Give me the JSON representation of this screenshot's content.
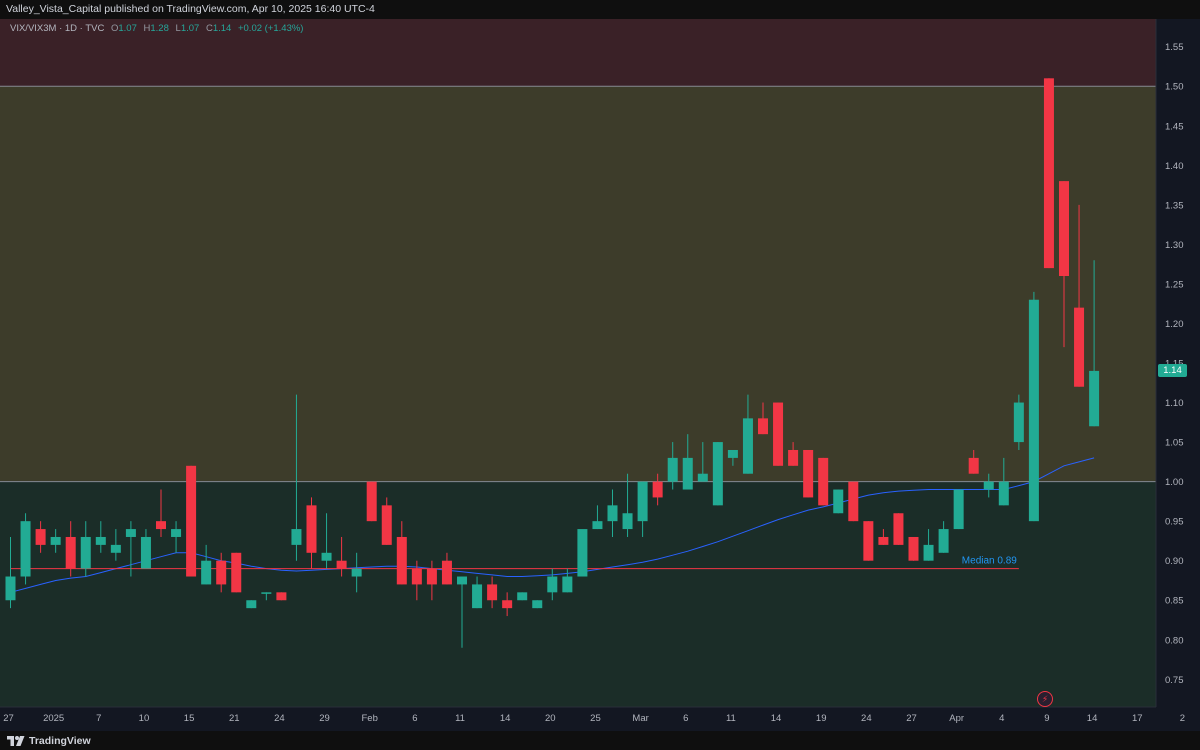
{
  "publisher": "Valley_Vista_Capital published on TradingView.com, Apr 10, 2025 16:40 UTC-4",
  "legend": {
    "symbol": "VIX/VIX3M · 1D · TVC",
    "open_label": "O",
    "open": "1.07",
    "high_label": "H",
    "high": "1.28",
    "low_label": "L",
    "low": "1.07",
    "close_label": "C",
    "close": "1.14",
    "change": "+0.02 (+1.43%)"
  },
  "footer": {
    "brand": "TradingView"
  },
  "colors": {
    "up": "#22ab94",
    "down": "#f23645",
    "ma": "#2962ff",
    "median_line": "#f23645",
    "median_label": "#2196f3",
    "zone_top": "#3a2127",
    "zone_mid": "#3d3c2a",
    "zone_low": "#1b2d28"
  },
  "chart_data": {
    "type": "candlestick",
    "ylim": [
      0.715,
      1.585
    ],
    "y_ticks": [
      "0.75",
      "0.80",
      "0.85",
      "0.90",
      "0.95",
      "1.00",
      "1.05",
      "1.10",
      "1.15",
      "1.20",
      "1.25",
      "1.30",
      "1.35",
      "1.40",
      "1.45",
      "1.50",
      "1.55"
    ],
    "x_ticks": [
      {
        "label": "27",
        "idx": 0
      },
      {
        "label": "2025",
        "idx": 3
      },
      {
        "label": "7",
        "idx": 6
      },
      {
        "label": "10",
        "idx": 9
      },
      {
        "label": "15",
        "idx": 12
      },
      {
        "label": "21",
        "idx": 15
      },
      {
        "label": "24",
        "idx": 18
      },
      {
        "label": "29",
        "idx": 21
      },
      {
        "label": "Feb",
        "idx": 24
      },
      {
        "label": "6",
        "idx": 27
      },
      {
        "label": "11",
        "idx": 30
      },
      {
        "label": "14",
        "idx": 33
      },
      {
        "label": "20",
        "idx": 36
      },
      {
        "label": "25",
        "idx": 39
      },
      {
        "label": "Mar",
        "idx": 42
      },
      {
        "label": "6",
        "idx": 45
      },
      {
        "label": "11",
        "idx": 48
      },
      {
        "label": "14",
        "idx": 51
      },
      {
        "label": "19",
        "idx": 54
      },
      {
        "label": "24",
        "idx": 57
      },
      {
        "label": "27",
        "idx": 60
      },
      {
        "label": "Apr",
        "idx": 63
      },
      {
        "label": "4",
        "idx": 66
      },
      {
        "label": "9",
        "idx": 69
      },
      {
        "label": "14",
        "idx": 72
      },
      {
        "label": "17",
        "idx": 75
      },
      {
        "label": "2",
        "idx": 78
      }
    ],
    "zones": [
      {
        "from": 1.5,
        "to": 1.585,
        "color": "#3a2127"
      },
      {
        "from": 1.0,
        "to": 1.5,
        "color": "#3d3c2a"
      },
      {
        "from": 0.715,
        "to": 1.0,
        "color": "#1b2d28"
      }
    ],
    "levels": [
      1.5,
      1.0
    ],
    "median": {
      "label": "Median 0.89",
      "value": 0.89,
      "from_idx": 0,
      "to_idx": 67
    },
    "last_price": "1.14",
    "candles": [
      {
        "o": 0.85,
        "h": 0.93,
        "l": 0.84,
        "c": 0.88
      },
      {
        "o": 0.88,
        "h": 0.96,
        "l": 0.87,
        "c": 0.95
      },
      {
        "o": 0.94,
        "h": 0.95,
        "l": 0.91,
        "c": 0.92
      },
      {
        "o": 0.92,
        "h": 0.94,
        "l": 0.91,
        "c": 0.93
      },
      {
        "o": 0.93,
        "h": 0.95,
        "l": 0.88,
        "c": 0.89
      },
      {
        "o": 0.89,
        "h": 0.95,
        "l": 0.88,
        "c": 0.93
      },
      {
        "o": 0.92,
        "h": 0.95,
        "l": 0.91,
        "c": 0.93
      },
      {
        "o": 0.91,
        "h": 0.94,
        "l": 0.9,
        "c": 0.92
      },
      {
        "o": 0.93,
        "h": 0.95,
        "l": 0.88,
        "c": 0.94
      },
      {
        "o": 0.89,
        "h": 0.94,
        "l": 0.89,
        "c": 0.93
      },
      {
        "o": 0.95,
        "h": 0.99,
        "l": 0.93,
        "c": 0.94
      },
      {
        "o": 0.93,
        "h": 0.95,
        "l": 0.91,
        "c": 0.94
      },
      {
        "o": 1.02,
        "h": 1.02,
        "l": 0.88,
        "c": 0.88
      },
      {
        "o": 0.87,
        "h": 0.92,
        "l": 0.87,
        "c": 0.9
      },
      {
        "o": 0.9,
        "h": 0.91,
        "l": 0.86,
        "c": 0.87
      },
      {
        "o": 0.91,
        "h": 0.91,
        "l": 0.86,
        "c": 0.86
      },
      {
        "o": 0.84,
        "h": 0.85,
        "l": 0.84,
        "c": 0.85
      },
      {
        "o": 0.86,
        "h": 0.86,
        "l": 0.85,
        "c": 0.86
      },
      {
        "o": 0.86,
        "h": 0.86,
        "l": 0.85,
        "c": 0.85
      },
      {
        "o": 0.92,
        "h": 1.11,
        "l": 0.9,
        "c": 0.94
      },
      {
        "o": 0.97,
        "h": 0.98,
        "l": 0.89,
        "c": 0.91
      },
      {
        "o": 0.9,
        "h": 0.96,
        "l": 0.89,
        "c": 0.91
      },
      {
        "o": 0.9,
        "h": 0.93,
        "l": 0.88,
        "c": 0.89
      },
      {
        "o": 0.88,
        "h": 0.91,
        "l": 0.86,
        "c": 0.89
      },
      {
        "o": 1.0,
        "h": 1.0,
        "l": 0.95,
        "c": 0.95
      },
      {
        "o": 0.97,
        "h": 0.98,
        "l": 0.92,
        "c": 0.92
      },
      {
        "o": 0.93,
        "h": 0.95,
        "l": 0.87,
        "c": 0.87
      },
      {
        "o": 0.89,
        "h": 0.9,
        "l": 0.85,
        "c": 0.87
      },
      {
        "o": 0.89,
        "h": 0.9,
        "l": 0.85,
        "c": 0.87
      },
      {
        "o": 0.9,
        "h": 0.91,
        "l": 0.87,
        "c": 0.87
      },
      {
        "o": 0.87,
        "h": 0.88,
        "l": 0.79,
        "c": 0.88
      },
      {
        "o": 0.84,
        "h": 0.88,
        "l": 0.84,
        "c": 0.87
      },
      {
        "o": 0.87,
        "h": 0.88,
        "l": 0.84,
        "c": 0.85
      },
      {
        "o": 0.85,
        "h": 0.86,
        "l": 0.83,
        "c": 0.84
      },
      {
        "o": 0.85,
        "h": 0.86,
        "l": 0.85,
        "c": 0.86
      },
      {
        "o": 0.84,
        "h": 0.85,
        "l": 0.84,
        "c": 0.85
      },
      {
        "o": 0.86,
        "h": 0.89,
        "l": 0.85,
        "c": 0.88
      },
      {
        "o": 0.86,
        "h": 0.89,
        "l": 0.86,
        "c": 0.88
      },
      {
        "o": 0.88,
        "h": 0.92,
        "l": 0.88,
        "c": 0.94
      },
      {
        "o": 0.94,
        "h": 0.97,
        "l": 0.94,
        "c": 0.95
      },
      {
        "o": 0.95,
        "h": 0.99,
        "l": 0.93,
        "c": 0.97
      },
      {
        "o": 0.94,
        "h": 1.01,
        "l": 0.93,
        "c": 0.96
      },
      {
        "o": 0.95,
        "h": 1.0,
        "l": 0.93,
        "c": 1.0
      },
      {
        "o": 1.0,
        "h": 1.01,
        "l": 0.97,
        "c": 0.98
      },
      {
        "o": 1.0,
        "h": 1.05,
        "l": 0.99,
        "c": 1.03
      },
      {
        "o": 0.99,
        "h": 1.06,
        "l": 0.99,
        "c": 1.03
      },
      {
        "o": 1.0,
        "h": 1.05,
        "l": 1.0,
        "c": 1.01
      },
      {
        "o": 0.97,
        "h": 1.05,
        "l": 0.97,
        "c": 1.05
      },
      {
        "o": 1.03,
        "h": 1.04,
        "l": 1.02,
        "c": 1.04
      },
      {
        "o": 1.01,
        "h": 1.11,
        "l": 1.01,
        "c": 1.08
      },
      {
        "o": 1.08,
        "h": 1.1,
        "l": 1.06,
        "c": 1.06
      },
      {
        "o": 1.1,
        "h": 1.1,
        "l": 1.02,
        "c": 1.02
      },
      {
        "o": 1.04,
        "h": 1.05,
        "l": 1.02,
        "c": 1.02
      },
      {
        "o": 1.04,
        "h": 1.04,
        "l": 0.98,
        "c": 0.98
      },
      {
        "o": 1.03,
        "h": 1.03,
        "l": 0.97,
        "c": 0.97
      },
      {
        "o": 0.96,
        "h": 0.99,
        "l": 0.96,
        "c": 0.99
      },
      {
        "o": 1.0,
        "h": 1.0,
        "l": 0.95,
        "c": 0.95
      },
      {
        "o": 0.95,
        "h": 0.95,
        "l": 0.9,
        "c": 0.9
      },
      {
        "o": 0.93,
        "h": 0.94,
        "l": 0.92,
        "c": 0.92
      },
      {
        "o": 0.96,
        "h": 0.96,
        "l": 0.92,
        "c": 0.92
      },
      {
        "o": 0.93,
        "h": 0.93,
        "l": 0.9,
        "c": 0.9
      },
      {
        "o": 0.9,
        "h": 0.94,
        "l": 0.9,
        "c": 0.92
      },
      {
        "o": 0.91,
        "h": 0.95,
        "l": 0.91,
        "c": 0.94
      },
      {
        "o": 0.94,
        "h": 0.99,
        "l": 0.94,
        "c": 0.99
      },
      {
        "o": 1.03,
        "h": 1.04,
        "l": 1.01,
        "c": 1.01
      },
      {
        "o": 0.99,
        "h": 1.01,
        "l": 0.98,
        "c": 1.0
      },
      {
        "o": 0.97,
        "h": 1.03,
        "l": 0.97,
        "c": 1.0
      },
      {
        "o": 1.05,
        "h": 1.11,
        "l": 1.04,
        "c": 1.1
      },
      {
        "o": 0.95,
        "h": 1.24,
        "l": 0.95,
        "c": 1.23
      },
      {
        "o": 1.51,
        "h": 1.51,
        "l": 1.27,
        "c": 1.27
      },
      {
        "o": 1.38,
        "h": 1.38,
        "l": 1.17,
        "c": 1.26
      },
      {
        "o": 1.22,
        "h": 1.35,
        "l": 1.12,
        "c": 1.12
      },
      {
        "o": 1.07,
        "h": 1.28,
        "l": 1.07,
        "c": 1.14
      }
    ],
    "ma": [
      0.86,
      0.865,
      0.87,
      0.875,
      0.878,
      0.88,
      0.885,
      0.89,
      0.895,
      0.9,
      0.905,
      0.91,
      0.91,
      0.905,
      0.9,
      0.897,
      0.893,
      0.89,
      0.888,
      0.887,
      0.888,
      0.889,
      0.89,
      0.891,
      0.892,
      0.893,
      0.893,
      0.892,
      0.89,
      0.888,
      0.886,
      0.884,
      0.882,
      0.88,
      0.88,
      0.881,
      0.882,
      0.884,
      0.886,
      0.889,
      0.892,
      0.895,
      0.898,
      0.902,
      0.907,
      0.912,
      0.918,
      0.924,
      0.931,
      0.938,
      0.945,
      0.952,
      0.958,
      0.964,
      0.968,
      0.973,
      0.978,
      0.983,
      0.986,
      0.988,
      0.989,
      0.99,
      0.99,
      0.99,
      0.99,
      0.99,
      0.99,
      0.995,
      1.0,
      1.01,
      1.02,
      1.025,
      1.03
    ]
  }
}
